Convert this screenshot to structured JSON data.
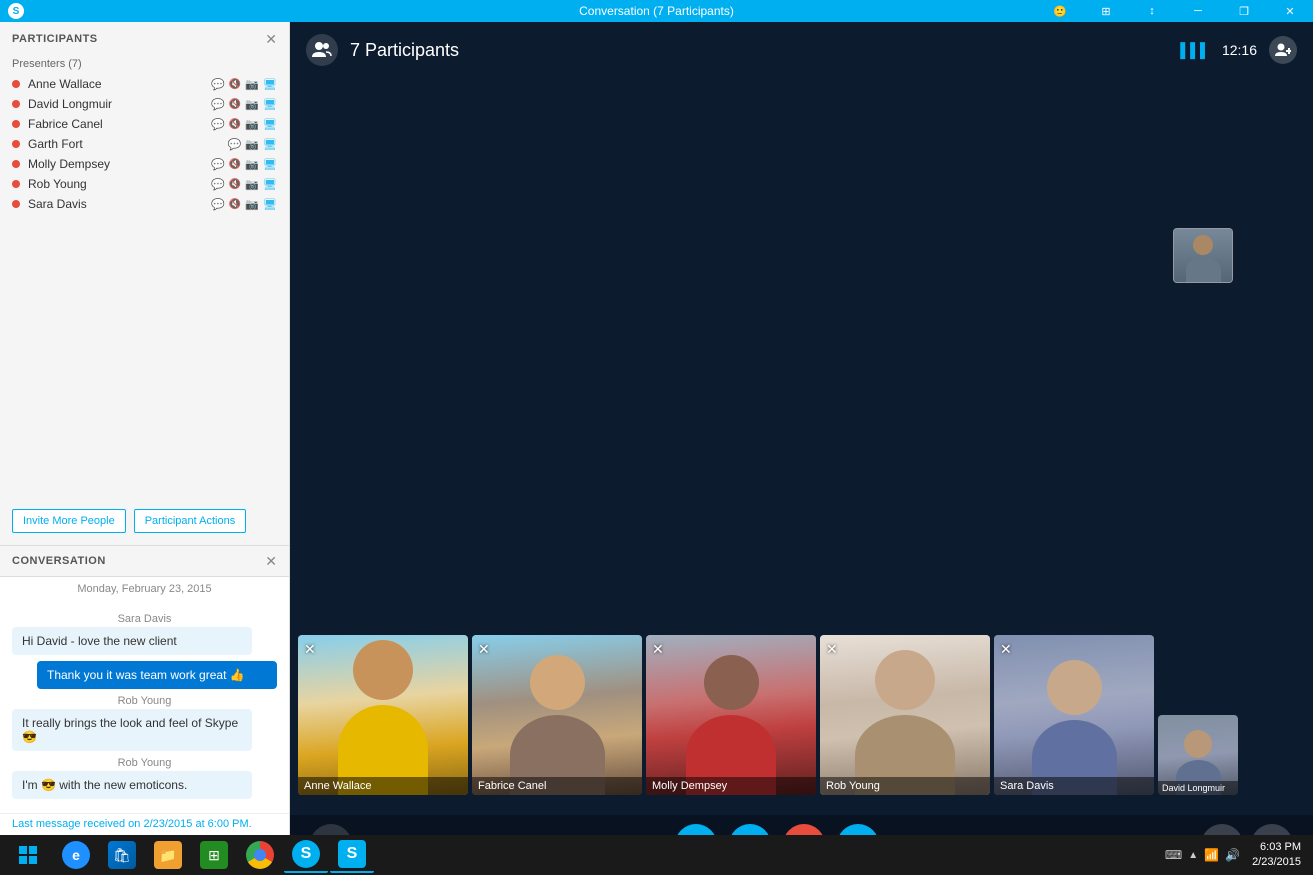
{
  "titlebar": {
    "title": "Conversation (7 Participants)",
    "controls": [
      "emoji",
      "layout",
      "minimize",
      "restore",
      "maximize",
      "close"
    ]
  },
  "left_panel": {
    "participants_title": "PARTICIPANTS",
    "presenters_label": "Presenters (7)",
    "participants": [
      {
        "name": "Anne Wallace",
        "has_chat": true,
        "muted": true,
        "has_cam": true,
        "has_monitor": true
      },
      {
        "name": "David Longmuir",
        "has_chat": true,
        "muted": true,
        "has_cam": true,
        "has_monitor": true
      },
      {
        "name": "Fabrice Canel",
        "has_chat": false,
        "muted": true,
        "has_cam": true,
        "has_monitor": true
      },
      {
        "name": "Garth Fort",
        "has_chat": true,
        "muted": false,
        "has_cam": true,
        "has_monitor": true
      },
      {
        "name": "Molly Dempsey",
        "has_chat": true,
        "muted": true,
        "has_cam": true,
        "has_monitor": true
      },
      {
        "name": "Rob Young",
        "has_chat": true,
        "muted": true,
        "has_cam": true,
        "has_monitor": true
      },
      {
        "name": "Sara Davis",
        "has_chat": true,
        "muted": true,
        "has_cam": true,
        "has_monitor": true
      }
    ],
    "invite_btn": "Invite More People",
    "actions_btn": "Participant Actions"
  },
  "conversation": {
    "title": "CONVERSATION",
    "date": "Monday, February 23, 2015",
    "messages": [
      {
        "sender": "Sara Davis",
        "text": "Hi David - love the new client",
        "is_self": false
      },
      {
        "sender": "",
        "text": "Thank you it was team work great 👍",
        "is_self": true
      },
      {
        "sender": "Rob Young",
        "text": "It really brings the look and feel of Skype 😎",
        "is_self": false
      },
      {
        "sender": "Rob Young",
        "text": "I'm 😎 with the new emoticons.",
        "is_self": false
      }
    ],
    "last_message": "Last message received on 2/23/2015 at 6:00 PM."
  },
  "video_area": {
    "participants_count": "7 Participants",
    "signal": "▌▌▌",
    "time": "12:16",
    "video_tiles": [
      {
        "name": "Anne Wallace",
        "muted": true
      },
      {
        "name": "Fabrice Canel",
        "muted": true
      },
      {
        "name": "Molly Dempsey",
        "muted": true
      },
      {
        "name": "Rob Young",
        "muted": true
      },
      {
        "name": "Sara Davis",
        "muted": true
      },
      {
        "name": "David Longmuir",
        "muted": false,
        "is_small": true
      }
    ]
  },
  "controls": {
    "chat": "💬",
    "video": "📹",
    "mic": "🎤",
    "screen": "🖥",
    "hangup": "📵",
    "people": "👥",
    "more": "•••"
  },
  "taskbar": {
    "start_icon": "⊞",
    "time": "6:03 PM",
    "date": "2/23/2015",
    "apps": [
      "IE",
      "Store",
      "Files",
      "Chrome",
      "Skype",
      "Skype2"
    ]
  }
}
